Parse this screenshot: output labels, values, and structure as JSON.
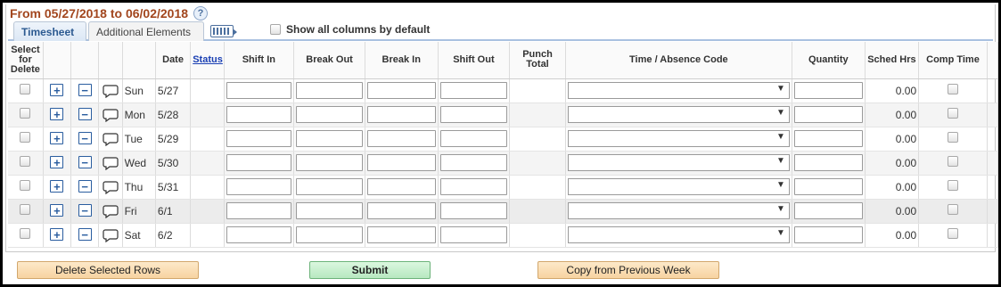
{
  "period": {
    "label": "From 05/27/2018 to 06/02/2018",
    "help_icon": "?"
  },
  "tabs": [
    {
      "label": "Timesheet",
      "active": true
    },
    {
      "label": "Additional Elements",
      "active": false
    }
  ],
  "show_all": {
    "label": "Show all columns by default",
    "checked": false
  },
  "columns": {
    "select": "Select for Delete",
    "date": "Date",
    "status": "Status",
    "shift_in": "Shift In",
    "break_out": "Break Out",
    "break_in": "Break In",
    "shift_out": "Shift Out",
    "punch_total": "Punch Total",
    "time_code": "Time / Absence Code",
    "quantity": "Quantity",
    "sched_hrs": "Sched Hrs",
    "comp_time": "Comp Time"
  },
  "rows": [
    {
      "day": "Sun",
      "date": "5/27",
      "sched_hrs": "0.00"
    },
    {
      "day": "Mon",
      "date": "5/28",
      "sched_hrs": "0.00"
    },
    {
      "day": "Tue",
      "date": "5/29",
      "sched_hrs": "0.00"
    },
    {
      "day": "Wed",
      "date": "5/30",
      "sched_hrs": "0.00"
    },
    {
      "day": "Thu",
      "date": "5/31",
      "sched_hrs": "0.00"
    },
    {
      "day": "Fri",
      "date": "6/1",
      "sched_hrs": "0.00"
    },
    {
      "day": "Sat",
      "date": "6/2",
      "sched_hrs": "0.00"
    }
  ],
  "buttons": {
    "delete": "Delete Selected Rows",
    "submit": "Submit",
    "copy": "Copy from Previous Week"
  },
  "icons": {
    "help": "help-icon",
    "show_all": "show-all-columns-icon",
    "add_row": "plus-icon",
    "remove_row": "minus-icon",
    "comment": "comment-bubble-icon",
    "dropdown": "chevron-down-icon"
  },
  "colors": {
    "period_header": "#a2461e",
    "tab_active_text": "#2c5a91",
    "status_link": "#1a3fb3",
    "row_button": "#2a5d9f",
    "delete_button_bg": "#f7d3a1",
    "submit_button_bg": "#b7e8c0",
    "copy_button_bg": "#f7d3a1"
  }
}
